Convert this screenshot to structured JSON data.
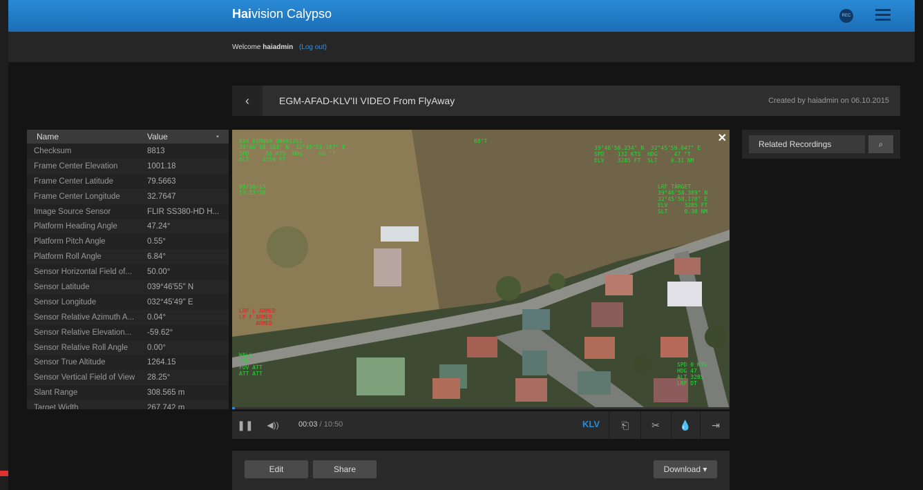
{
  "app": {
    "brand_bold": "Hai",
    "brand_rest": "vision Calypso",
    "rec_badge": "REC"
  },
  "welcome": {
    "prefix": "Welcome",
    "user": "haiadmin",
    "logout": "(Log out)"
  },
  "video": {
    "title": "EGM-AFAD-KLV'II VIDEO From FlyAway",
    "created": "Created by haiadmin on 06.10.2015",
    "close": "✕"
  },
  "klv_table": {
    "header_name": "Name",
    "header_value": "Value",
    "rows": [
      {
        "name": "Checksum",
        "value": "8813"
      },
      {
        "name": "Frame Center Elevation",
        "value": "1001.18"
      },
      {
        "name": "Frame Center Latitude",
        "value": "79.5663"
      },
      {
        "name": "Frame Center Longitude",
        "value": "32.7647"
      },
      {
        "name": "Image Source Sensor",
        "value": "FLIR SS380-HD H..."
      },
      {
        "name": "Platform Heading Angle",
        "value": "47.24°"
      },
      {
        "name": "Platform Pitch Angle",
        "value": "0.55°"
      },
      {
        "name": "Platform Roll Angle",
        "value": "6.84°"
      },
      {
        "name": "Sensor Horizontal Field of...",
        "value": "50.00°"
      },
      {
        "name": "Sensor Latitude",
        "value": "039°46'55\" N"
      },
      {
        "name": "Sensor Longitude",
        "value": "032°45'49\" E"
      },
      {
        "name": "Sensor Relative Azimuth A...",
        "value": "0.04°"
      },
      {
        "name": "Sensor Relative Elevation...",
        "value": "-59.62°"
      },
      {
        "name": "Sensor Relative Roll Angle",
        "value": "0.00°"
      },
      {
        "name": "Sensor True Altitude",
        "value": "1264.15"
      },
      {
        "name": "Sensor Vertical Field of View",
        "value": "28.25°"
      },
      {
        "name": "Slant Range",
        "value": "308.565 m"
      },
      {
        "name": "Target Width",
        "value": "267.742 m"
      }
    ]
  },
  "player": {
    "current_time": "00:03",
    "total_time": " / 10:50",
    "klv_label": "KLV",
    "progress": 0.005
  },
  "actions": {
    "edit": "Edit",
    "share": "Share",
    "download": "Download ▾"
  },
  "related": {
    "label": "Related Recordings"
  },
  "hud": {
    "tl": "ASd EGM06A SN601351\n39°46'58.184\" N  32°45'51.187\" E\nSPD     66 KTS  HDG     66 °T\nALT    4159 FT",
    "tc": "68°T",
    "tr": "39°46'58.234\" N  32°45'59.047\" E\nSPD    132 KTS  HDG     47 °T\nELV    3285 FT  SLT    0.31 NM",
    "date": "09/10/15\n13:13:38",
    "lrf": "LRF TARGET\n39°46'58.389\" N\n32°45'58.178\" E\nELV     3285 FT\nSLT     0.30 NM",
    "armed": "LRF L ARMED\nLP F ARMED\n     ARMED",
    "bl": "WALL\nSCN\nFOV ATT\nATT ATT",
    "br": "SPD 0 KTS\nHDG 47\nALT 3285\nLRF DT"
  }
}
